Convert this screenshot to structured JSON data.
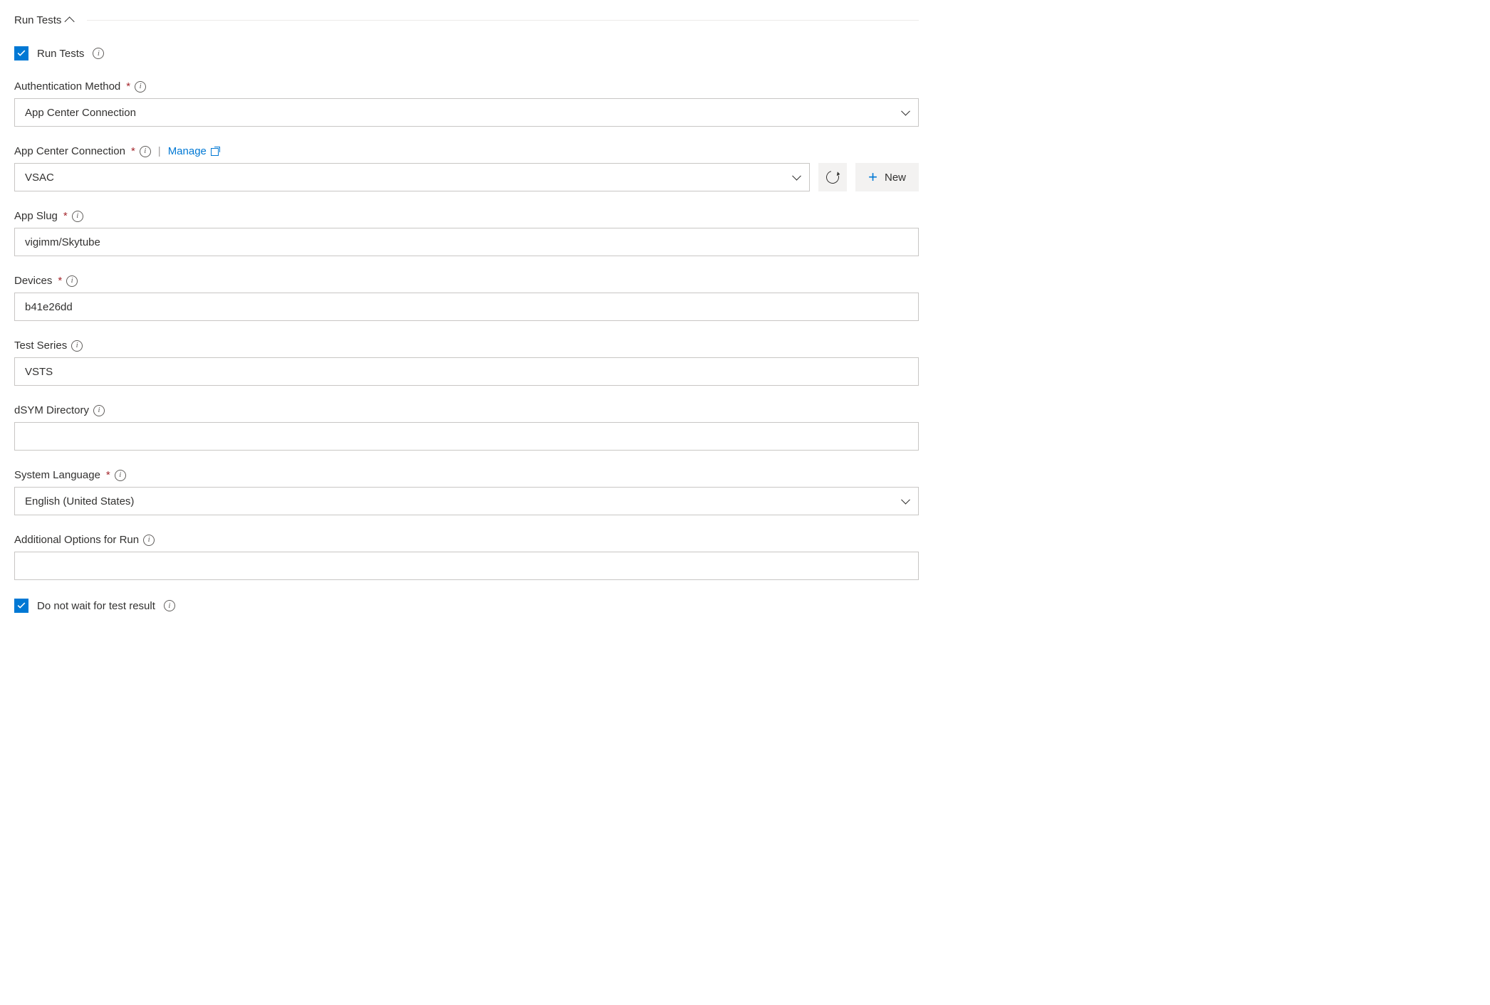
{
  "section": {
    "title": "Run Tests"
  },
  "runTestsCheckbox": {
    "label": "Run Tests",
    "checked": true
  },
  "fields": {
    "authMethod": {
      "label": "Authentication Method",
      "required": true,
      "value": "App Center Connection"
    },
    "appCenterConnection": {
      "label": "App Center Connection",
      "required": true,
      "manageLabel": "Manage",
      "value": "VSAC",
      "newButtonLabel": "New"
    },
    "appSlug": {
      "label": "App Slug",
      "required": true,
      "value": "vigimm/Skytube"
    },
    "devices": {
      "label": "Devices",
      "required": true,
      "value": "b41e26dd"
    },
    "testSeries": {
      "label": "Test Series",
      "required": false,
      "value": "VSTS"
    },
    "dsymDirectory": {
      "label": "dSYM Directory",
      "required": false,
      "value": ""
    },
    "systemLanguage": {
      "label": "System Language",
      "required": true,
      "value": "English (United States)"
    },
    "additionalOptions": {
      "label": "Additional Options for Run",
      "required": false,
      "value": ""
    }
  },
  "doNotWaitCheckbox": {
    "label": "Do not wait for test result",
    "checked": true
  }
}
